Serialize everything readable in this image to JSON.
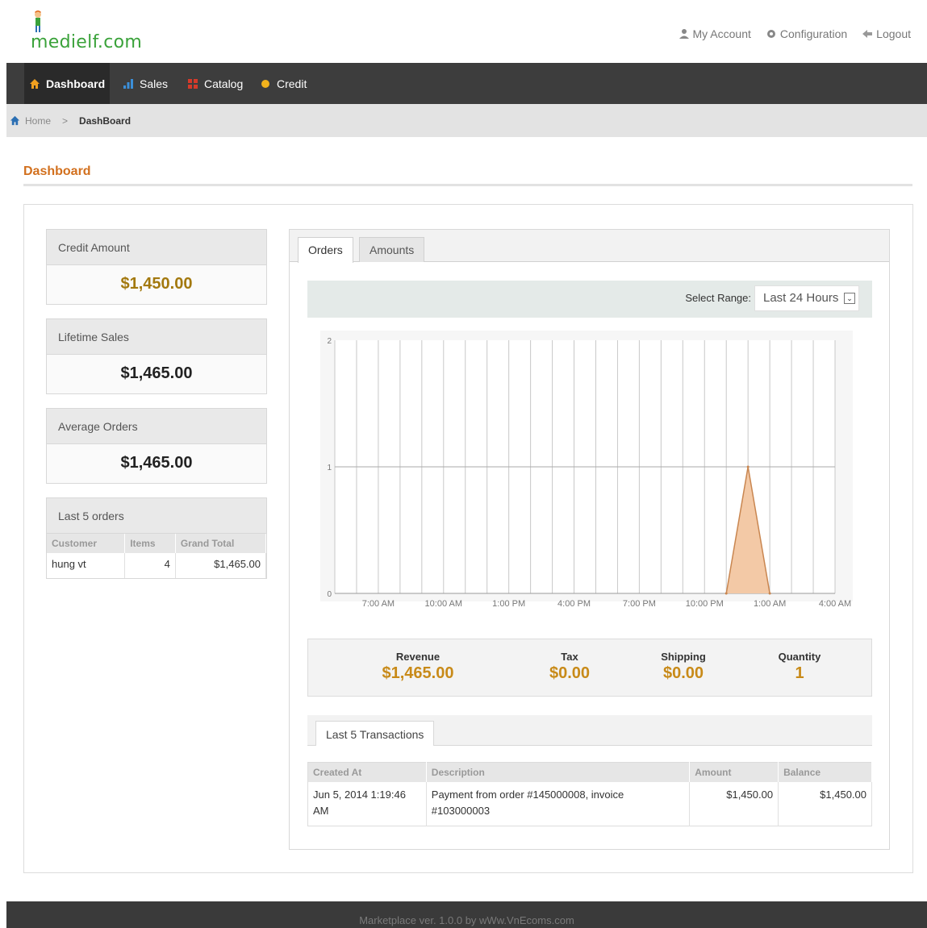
{
  "header": {
    "logo_text": "medielf.com",
    "links": {
      "my_account": "My Account",
      "configuration": "Configuration",
      "logout": "Logout"
    }
  },
  "nav": {
    "items": [
      {
        "label": "Dashboard",
        "icon": "home-icon",
        "active": true
      },
      {
        "label": "Sales",
        "icon": "bar-chart-icon",
        "active": false
      },
      {
        "label": "Catalog",
        "icon": "catalog-icon",
        "active": false
      },
      {
        "label": "Credit",
        "icon": "credit-dot-icon",
        "active": false
      }
    ]
  },
  "breadcrumb": {
    "home": "Home",
    "separator": ">",
    "current": "DashBoard"
  },
  "page": {
    "title": "Dashboard"
  },
  "widgets": {
    "credit_amount": {
      "label": "Credit Amount",
      "value": "$1,450.00"
    },
    "lifetime_sales": {
      "label": "Lifetime Sales",
      "value": "$1,465.00"
    },
    "average_orders": {
      "label": "Average Orders",
      "value": "$1,465.00"
    },
    "last_orders": {
      "label": "Last 5 orders",
      "columns": [
        "Customer",
        "Items",
        "Grand Total"
      ],
      "rows": [
        {
          "customer": "hung vt",
          "items": "4",
          "grand_total": "$1,465.00"
        }
      ]
    }
  },
  "tabs": {
    "orders": "Orders",
    "amounts": "Amounts"
  },
  "range": {
    "label": "Select Range:",
    "selected": "Last 24 Hours",
    "arrow": "⌄"
  },
  "chart_data": {
    "type": "area",
    "x": [
      "7:00 AM",
      "10:00 AM",
      "1:00 PM",
      "4:00 PM",
      "7:00 PM",
      "10:00 PM",
      "1:00 AM",
      "4:00 AM"
    ],
    "y_ticks": [
      "0",
      "1",
      "2"
    ],
    "ylim": [
      0,
      2
    ],
    "series": [
      {
        "points": [
          [
            18,
            0
          ],
          [
            19,
            1
          ],
          [
            20,
            0
          ]
        ]
      }
    ],
    "hours_start_label": "7:00 AM",
    "grid": true,
    "colors": {
      "fill": "#f3c9a6",
      "line": "#c98650",
      "grid": "#c8c8c8"
    }
  },
  "stats": {
    "revenue": {
      "label": "Revenue",
      "value": "$1,465.00"
    },
    "tax": {
      "label": "Tax",
      "value": "$0.00"
    },
    "shipping": {
      "label": "Shipping",
      "value": "$0.00"
    },
    "quantity": {
      "label": "Quantity",
      "value": "1"
    }
  },
  "transactions": {
    "tab_label": "Last 5 Transactions",
    "columns": [
      "Created At",
      "Description",
      "Amount",
      "Balance"
    ],
    "rows": [
      {
        "created_at": "Jun 5, 2014 1:19:46 AM",
        "description": "Payment from order #145000008, invoice #103000003",
        "amount": "$1,450.00",
        "balance": "$1,450.00"
      }
    ]
  },
  "footer": {
    "text": "Marketplace ver. 1.0.0 by wWw.VnEcoms.com"
  },
  "colors": {
    "accent": "#d2701e",
    "navbar": "#3d3d3d",
    "value_gold": "#c88a18"
  }
}
